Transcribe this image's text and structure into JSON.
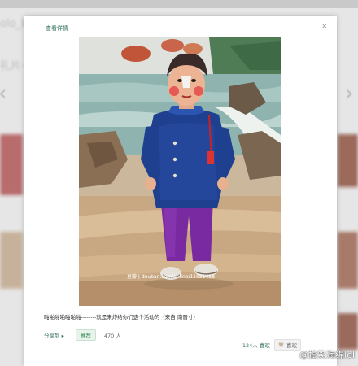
{
  "background": {
    "top_left_text": "olo_b",
    "side_text": "礼片~"
  },
  "modal": {
    "title": "查看详情",
    "close_glyph": "×"
  },
  "photo": {
    "watermark": "豆瓣 | douban.com/online/11951458"
  },
  "caption": "啪啪啪啪啪啪啪--------就是来炸给你们这个活动的（来自 南晋寸）",
  "actions": {
    "share_label": "分享到 ▸",
    "recommend_label": "推荐",
    "recommend_count": "470 人",
    "likes_count": "124人 喜欢",
    "like_label": "喜欢"
  },
  "corner_watermark": "@搞笑海绵lol",
  "colors": {
    "accent_green": "#2f6f5a",
    "coat_blue": "#1f3f8f",
    "pants_purple": "#7a2aa0"
  }
}
